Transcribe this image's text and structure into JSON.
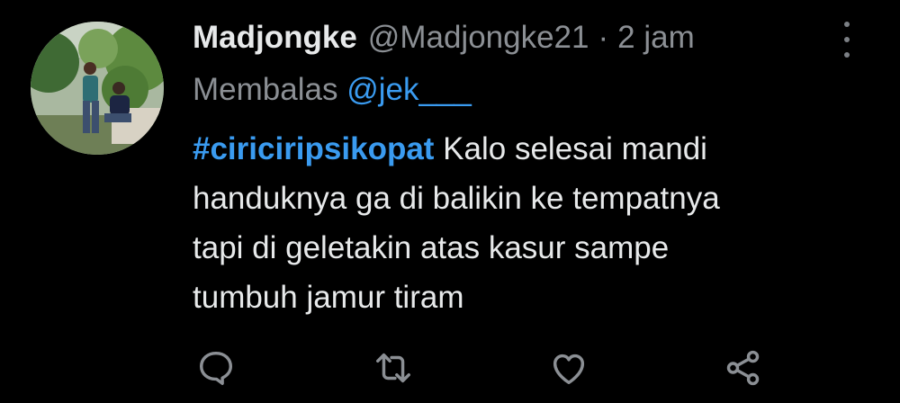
{
  "tweet": {
    "display_name": "Madjongke",
    "handle": "@Madjongke21",
    "separator": "·",
    "time": "2 jam",
    "reply_label": "Membalas",
    "reply_to": "@jek___",
    "hashtag": "#ciriciripsikopat",
    "text_lines": [
      " Kalo selesai mandi",
      "handuknya ga di balikin ke tempatnya",
      "tapi di geletakin atas kasur sampe",
      "tumbuh jamur tiram"
    ]
  },
  "icons": {
    "more": "more-vertical-icon",
    "reply": "comment-icon",
    "retweet": "retweet-icon",
    "like": "heart-icon",
    "share": "share-icon"
  },
  "colors": {
    "background": "#000000",
    "text": "#e7e9ea",
    "secondary": "#8b8f94",
    "link": "#3a9bf0"
  }
}
